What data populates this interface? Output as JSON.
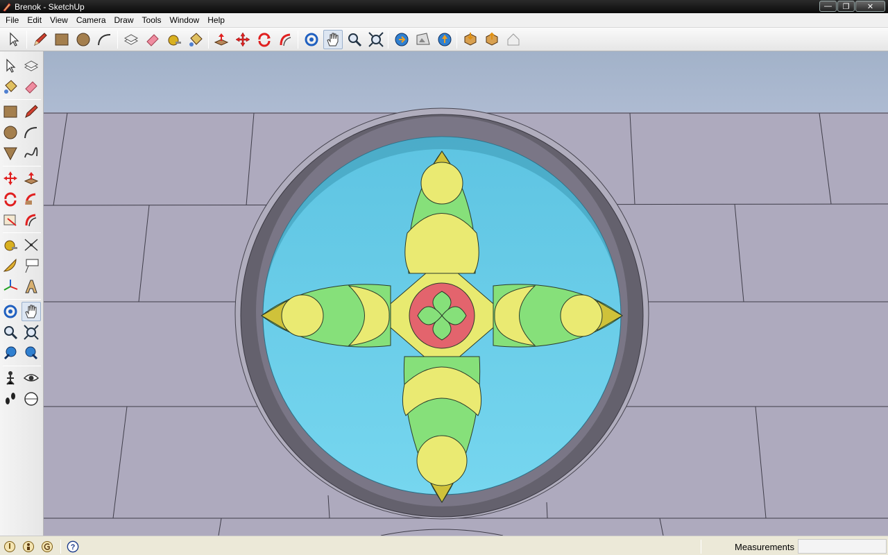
{
  "window": {
    "title": "Brenok - SketchUp"
  },
  "menubar": {
    "items": [
      "File",
      "Edit",
      "View",
      "Camera",
      "Draw",
      "Tools",
      "Window",
      "Help"
    ]
  },
  "toolbar": {
    "tools": [
      "select",
      "line",
      "rectangle",
      "circle",
      "arc",
      "make-component",
      "eraser",
      "tape-measure",
      "paint-bucket",
      "push-pull",
      "move",
      "rotate",
      "follow-me",
      "orbit",
      "pan",
      "zoom",
      "zoom-extents",
      "get-models",
      "share-model",
      "upload-component",
      "get-photo-textures",
      "export-to-google-earth",
      "toggle-terrain"
    ],
    "active_tool": "pan"
  },
  "statusbar": {
    "measurements_label": "Measurements",
    "measurements_value": ""
  },
  "colors": {
    "sky": "#a7b5cc",
    "ground": "#aeaabe",
    "water": "#6ccce6",
    "rim": "#5e5b66",
    "petal_green": "#86e07a",
    "petal_yellow": "#eaea72",
    "center_red": "#e3646d"
  }
}
